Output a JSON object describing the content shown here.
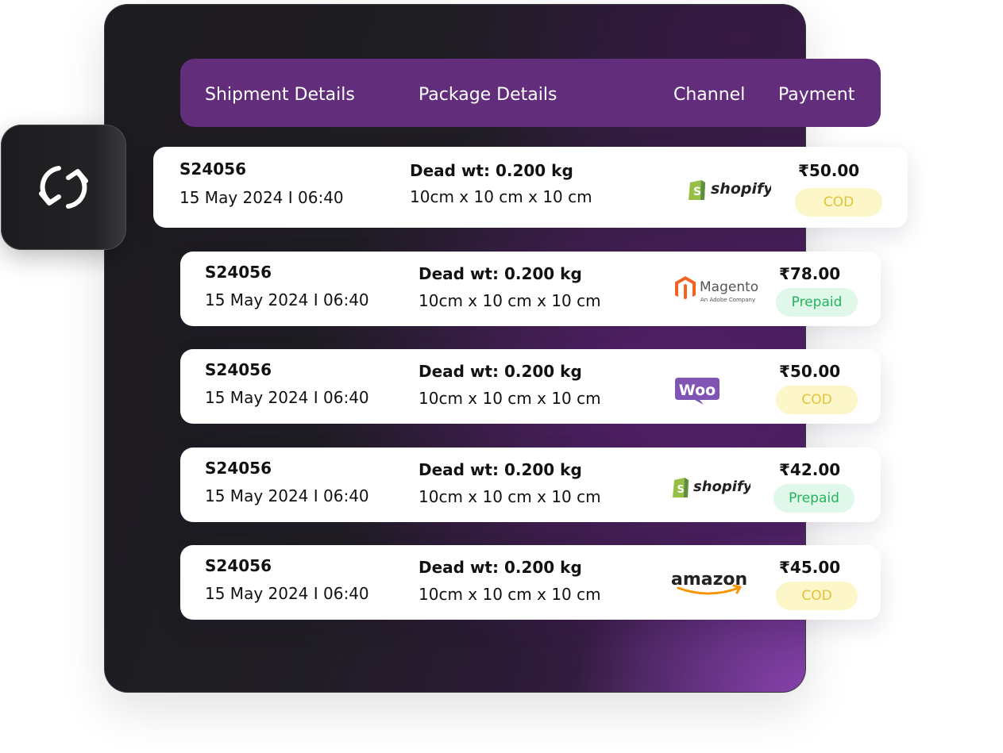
{
  "header": {
    "shipment": "Shipment Details",
    "package": "Package Details",
    "channel": "Channel",
    "payment": "Payment"
  },
  "rows": [
    {
      "id": "S24056",
      "date": "15 May 2024 I 06:40",
      "weight": "Dead wt: 0.200 kg",
      "dims": "10cm x 10 cm x 10 cm",
      "channel": "shopify",
      "amount": "₹50.00",
      "payment": "COD"
    },
    {
      "id": "S24056",
      "date": "15 May 2024 I 06:40",
      "weight": "Dead wt: 0.200 kg",
      "dims": "10cm x 10 cm x 10 cm",
      "channel": "Magento",
      "channel_sub": "An Adobe Company",
      "amount": "₹78.00",
      "payment": "Prepaid"
    },
    {
      "id": "S24056",
      "date": "15 May 2024 I 06:40",
      "weight": "Dead wt: 0.200 kg",
      "dims": "10cm x 10 cm x 10 cm",
      "channel": "Woo",
      "amount": "₹50.00",
      "payment": "COD"
    },
    {
      "id": "S24056",
      "date": "15 May 2024 I 06:40",
      "weight": "Dead wt: 0.200 kg",
      "dims": "10cm x 10 cm x 10 cm",
      "channel": "shopify",
      "amount": "₹42.00",
      "payment": "Prepaid"
    },
    {
      "id": "S24056",
      "date": "15 May 2024 I 06:40",
      "weight": "Dead wt: 0.200 kg",
      "dims": "10cm x 10 cm x 10 cm",
      "channel": "amazon",
      "amount": "₹45.00",
      "payment": "COD"
    }
  ],
  "icons": {
    "sync": "sync-icon",
    "shopify": "shopify-logo",
    "magento": "magento-logo",
    "woo": "woocommerce-logo",
    "amazon": "amazon-logo"
  },
  "colors": {
    "header_bg": "#622e7c",
    "cod_bg": "#fdf6c9",
    "cod_text": "#e2c23a",
    "prepaid_bg": "#e0f8ea",
    "prepaid_text": "#22b55c"
  }
}
